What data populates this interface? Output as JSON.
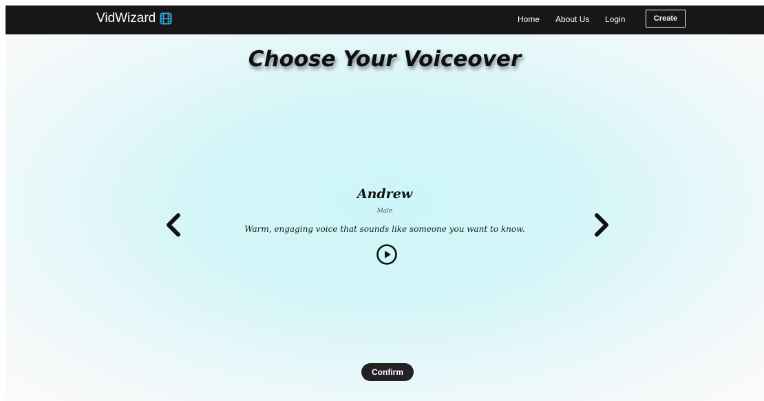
{
  "navbar": {
    "brand": "VidWizard",
    "brand_icon": "film-icon",
    "brand_icon_color": "#2aa8d8",
    "links": {
      "home": "Home",
      "about": "About Us",
      "login": "Login"
    },
    "create_label": "Create"
  },
  "main": {
    "title": "Choose Your Voiceover",
    "voice": {
      "name": "Andrew",
      "gender": "Male",
      "description": "Warm, engaging voice that sounds like someone you want to know."
    },
    "prev_icon": "chevron-left-icon",
    "next_icon": "chevron-right-icon",
    "play_icon": "play-circle-icon",
    "confirm_label": "Confirm"
  },
  "colors": {
    "navbar_bg": "#181616",
    "background": "#d3f5f8",
    "confirm_bg": "#232123"
  }
}
